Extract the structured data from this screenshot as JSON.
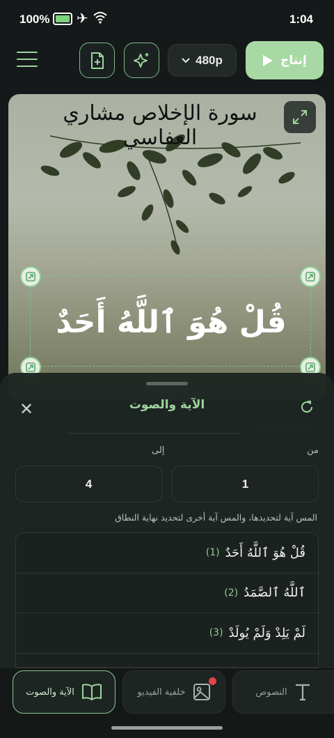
{
  "status_bar": {
    "battery": "100%",
    "time": "1:04"
  },
  "toolbar": {
    "resolution": "480p",
    "render_label": "إنتاج"
  },
  "preview": {
    "calligraphy_title": "سورة الإخلاص مشاري العفاسي",
    "verse_text": "قُلْ هُوَ ٱللَّهُ أَحَدٌ"
  },
  "sheet": {
    "title": "الآية والصوت",
    "from_label": "من",
    "to_label": "إلى",
    "from_value": "1",
    "to_value": "4",
    "hint": "المس آية لتحديدها، والمس آية أخرى لتحديد نهاية النطاق",
    "ayahs": [
      {
        "text": "قُلْ هُوَ ٱللَّهُ أَحَدٌ",
        "number": "(1)"
      },
      {
        "text": "ٱللَّهُ ٱلصَّمَدُ",
        "number": "(2)"
      },
      {
        "text": "لَمْ يَلِدْ وَلَمْ يُولَدْ",
        "number": "(3)"
      }
    ]
  },
  "bottom_nav": {
    "verse_audio": "الآية والصوت",
    "video_background": "خلفية الفيديو",
    "texts": "النصوص"
  },
  "colors": {
    "accent": "#a8d9a4",
    "accent_text": "#9fd49f",
    "background": "#15191a",
    "badge": "#e04646"
  }
}
